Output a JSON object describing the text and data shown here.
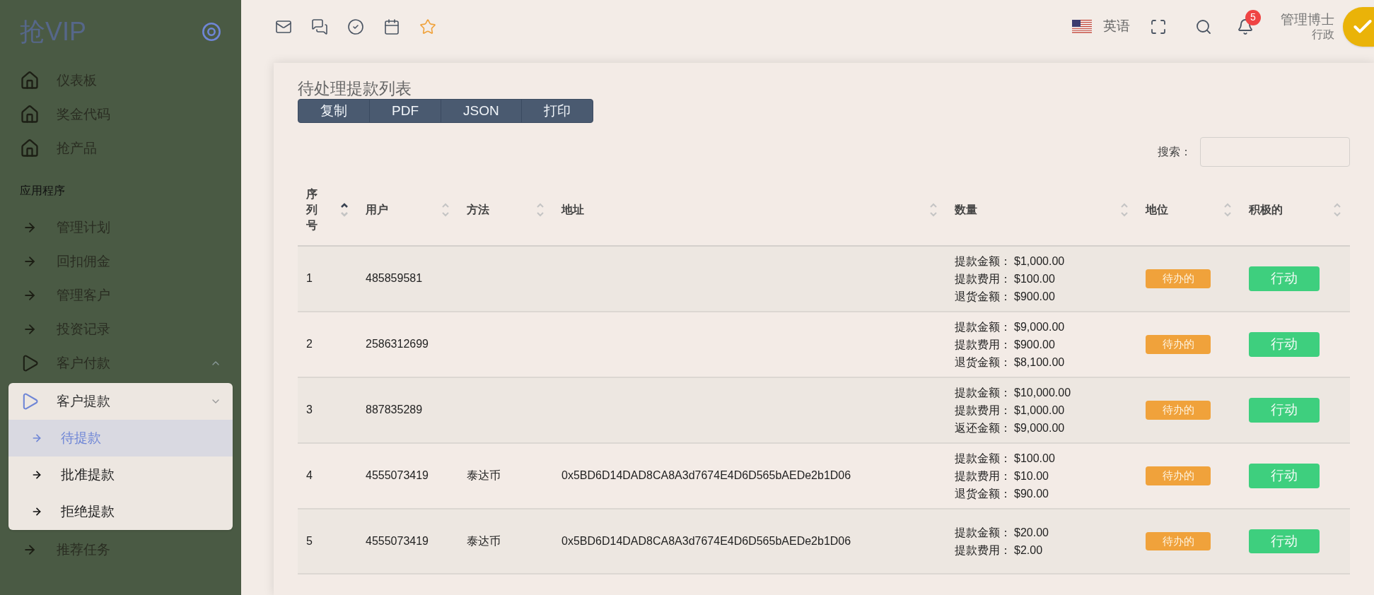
{
  "sidebar": {
    "logo": "抢VIP",
    "items": [
      {
        "label": "仪表板",
        "kind": "home"
      },
      {
        "label": "奖金代码",
        "kind": "home"
      },
      {
        "label": "抢产品",
        "kind": "home"
      },
      {
        "label": "应用程序",
        "kind": "heading"
      },
      {
        "label": "管理计划",
        "kind": "arrow"
      },
      {
        "label": "回扣佣金",
        "kind": "arrow"
      },
      {
        "label": "管理客户",
        "kind": "arrow"
      },
      {
        "label": "投资记录",
        "kind": "arrow"
      },
      {
        "label": "客户付款",
        "kind": "play",
        "expanded": false
      },
      {
        "label": "客户提款",
        "kind": "play",
        "expanded": true,
        "children": [
          {
            "label": "待提款",
            "selected": true
          },
          {
            "label": "批准提款",
            "selected": false
          },
          {
            "label": "拒绝提款",
            "selected": false
          }
        ]
      },
      {
        "label": "推荐任务",
        "kind": "arrow"
      }
    ]
  },
  "topbar": {
    "language": "英语",
    "notifications": "5",
    "user_name": "管理博士",
    "user_role": "行政"
  },
  "card": {
    "title": "待处理提款列表",
    "export_buttons": [
      "复制",
      "PDF",
      "JSON",
      "打印"
    ],
    "search_label": "搜索："
  },
  "table": {
    "columns": [
      {
        "label": "序列号",
        "sorted": true
      },
      {
        "label": "用户",
        "sorted": false
      },
      {
        "label": "方法",
        "sorted": false
      },
      {
        "label": "地址",
        "sorted": false
      },
      {
        "label": "数量",
        "sorted": false
      },
      {
        "label": "地位",
        "sorted": false
      },
      {
        "label": "积极的",
        "sorted": false
      }
    ],
    "rows": [
      {
        "index": "1",
        "user": "485859581",
        "amounts": [
          {
            "label": "提款金额：",
            "value": "$1,000.00"
          },
          {
            "label": "提款费用：",
            "value": "$100.00"
          },
          {
            "label": "退货金额：",
            "value": "$900.00"
          }
        ],
        "status": "待办的",
        "action": "行动"
      },
      {
        "index": "2",
        "user": "2586312699",
        "amounts": [
          {
            "label": "提款金额：",
            "value": "$9,000.00"
          },
          {
            "label": "提款费用：",
            "value": "$900.00"
          },
          {
            "label": "退货金额：",
            "value": "$8,100.00"
          }
        ],
        "status": "待办的",
        "action": "行动"
      },
      {
        "index": "3",
        "user": "887835289",
        "amounts": [
          {
            "label": "提款金额：",
            "value": "$10,000.00"
          },
          {
            "label": "提款费用：",
            "value": "$1,000.00"
          },
          {
            "label": "返还金额：",
            "value": "$9,000.00"
          }
        ],
        "status": "待办的",
        "action": "行动"
      },
      {
        "index": "4",
        "user": "4555073419",
        "method": "泰达币",
        "address": "0x5BD6D14DAD8CA8A3d7674E4D6D565bAEDe2b1D06",
        "amounts": [
          {
            "label": "提款金额：",
            "value": "$100.00"
          },
          {
            "label": "提款费用：",
            "value": "$10.00"
          },
          {
            "label": "退货金额：",
            "value": "$90.00"
          }
        ],
        "status": "待办的",
        "action": "行动"
      },
      {
        "index": "5",
        "user": "4555073419",
        "method": "泰达币",
        "address": "0x5BD6D14DAD8CA8A3d7674E4D6D565bAEDe2b1D06",
        "amounts": [
          {
            "label": "提款金额：",
            "value": "$20.00"
          },
          {
            "label": "提款费用：",
            "value": "$2.00"
          }
        ],
        "status": "待办的",
        "action": "行动"
      }
    ]
  }
}
